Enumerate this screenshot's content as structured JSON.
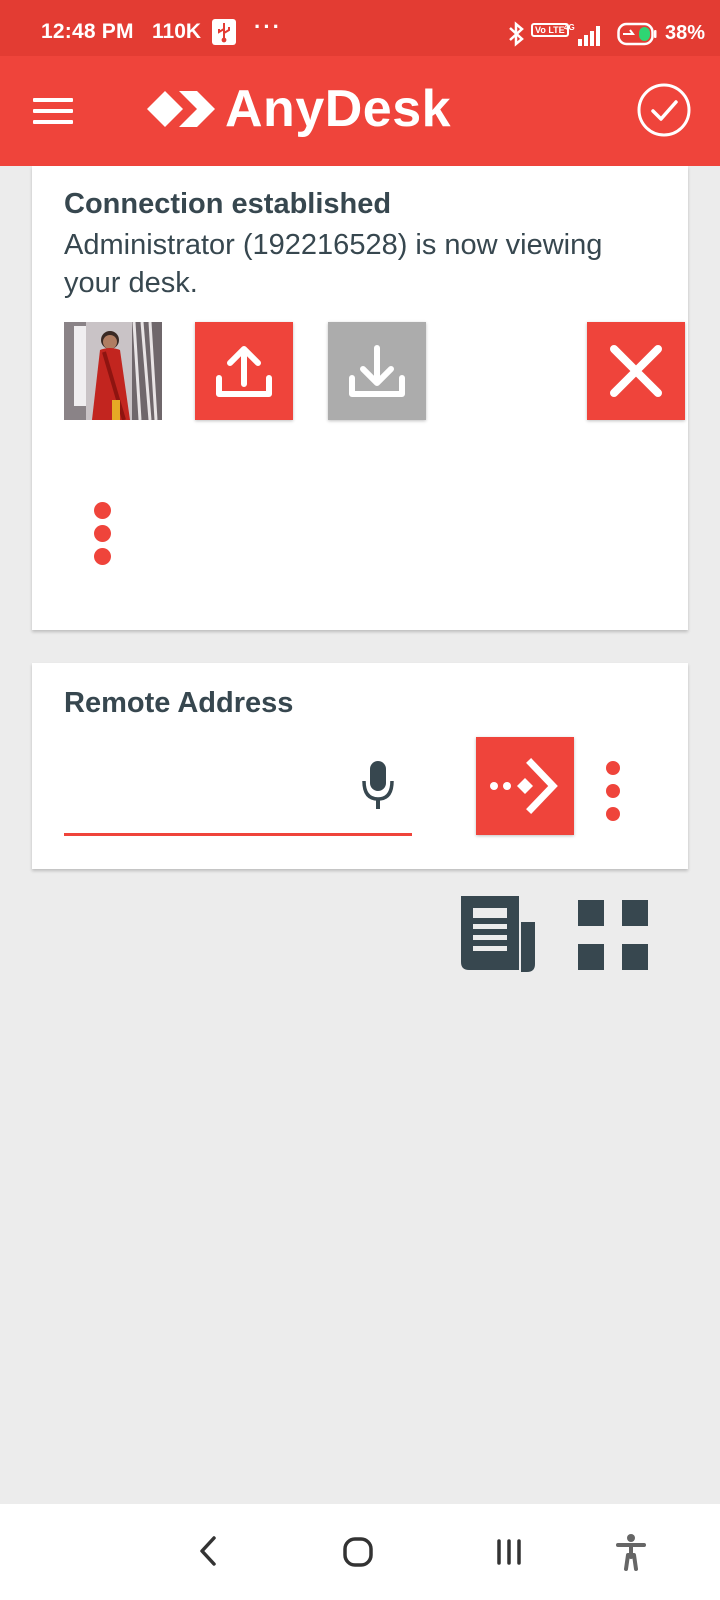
{
  "status_bar": {
    "time": "12:48 PM",
    "net_speed": "110K",
    "more_dots": "···",
    "volte": "Vo LTE",
    "network": "4G",
    "battery_pct": "38%",
    "icons": [
      "usb-icon",
      "bluetooth-icon",
      "volte-icon",
      "signal-icon",
      "battery-icon"
    ]
  },
  "app_bar": {
    "brand": "AnyDesk",
    "icons": [
      "menu-icon",
      "anydesk-logo",
      "check-circle-icon"
    ]
  },
  "connection_card": {
    "title": "Connection established",
    "message": "Administrator (192216528) is now viewing your desk.",
    "buttons": [
      "upload-icon",
      "download-icon",
      "close-icon",
      "more-vert-icon"
    ]
  },
  "remote_card": {
    "title": "Remote Address",
    "address_value": "",
    "address_placeholder": "",
    "icons": [
      "mic-icon",
      "connect-arrow-icon",
      "more-vert-icon"
    ]
  },
  "shortcuts": {
    "icons": [
      "news-icon",
      "grid-view-icon"
    ]
  },
  "colors": {
    "status_bar": "#e33c33",
    "app_bar": "#ef443b",
    "accent": "#ef443b",
    "disabled": "#acacac",
    "text": "#37474f",
    "background": "#ececec",
    "icon_dark": "#37474f"
  },
  "nav_bar": {
    "icons": [
      "back-icon",
      "home-icon",
      "recents-icon",
      "accessibility-icon"
    ]
  }
}
